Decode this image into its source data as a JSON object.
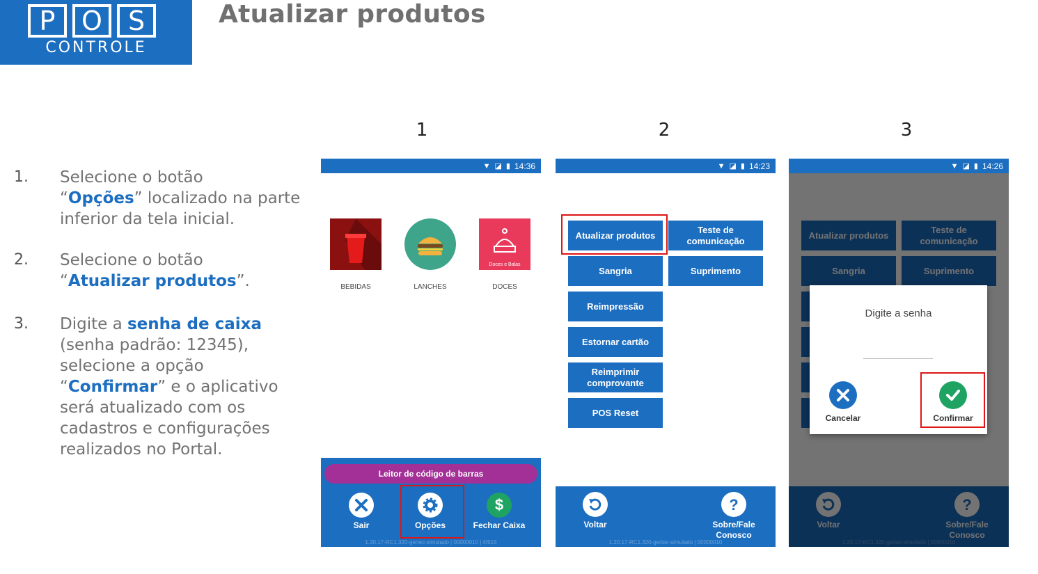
{
  "logo": {
    "letters": [
      "P",
      "O",
      "S"
    ],
    "subtitle": "CONTROLE"
  },
  "page_title": "Atualizar produtos",
  "steps": [
    {
      "num": "1.",
      "parts": [
        "Selecione o botão",
        "“",
        "Opções",
        "” localizado na parte inferior da tela inicial."
      ]
    },
    {
      "num": "2.",
      "parts": [
        "Selecione o botão",
        "“",
        "Atualizar produtos",
        "”."
      ]
    },
    {
      "num": "3.",
      "parts": [
        "Digite a ",
        "senha de caixa",
        " (senha padrão: 12345), selecione a opção ",
        "“",
        "Confirmar",
        "” e o aplicativo será atualizado com os cadastros e configurações realizados no Portal."
      ]
    }
  ],
  "column_numbers": [
    "1",
    "2",
    "3"
  ],
  "screen1": {
    "time": "14:36",
    "categories": [
      {
        "label": "BEBIDAS",
        "icon": "cup-icon"
      },
      {
        "label": "LANCHES",
        "icon": "burger-icon"
      },
      {
        "label": "DOCES",
        "icon": "cake-icon",
        "image_text": "Doces e Balas"
      }
    ],
    "barcode_label": "Leitor de código de barras",
    "bottom_buttons": [
      {
        "label": "Sair",
        "icon": "close-icon"
      },
      {
        "label": "Opções",
        "icon": "gear-icon"
      },
      {
        "label": "Fechar Caixa",
        "icon": "dollar-icon"
      }
    ],
    "version": "1.20.17-RC1.320-gertec-simulado | 00000010 | 4f515"
  },
  "screen2": {
    "time": "14:23",
    "menu": [
      "Atualizar produtos",
      "Teste de comunicação",
      "Sangria",
      "Suprimento",
      "Reimpressão",
      "Estornar cartão",
      "Reimprimir comprovante",
      "POS Reset"
    ],
    "bottom_buttons": [
      {
        "label": "Voltar",
        "icon": "undo-icon"
      },
      {
        "label": "Sobre/Fale Conosco",
        "icon": "help-icon"
      }
    ],
    "version": "1.20.17-RC1.320-gertec-simulado | 00000010"
  },
  "screen3": {
    "time": "14:26",
    "dialog_title": "Digite a senha",
    "cancel_label": "Cancelar",
    "confirm_label": "Confirmar"
  },
  "colors": {
    "brand_blue": "#1c6ec0",
    "purple": "#a23096",
    "highlight_red": "#e01515",
    "confirm_green": "#1ea362"
  }
}
